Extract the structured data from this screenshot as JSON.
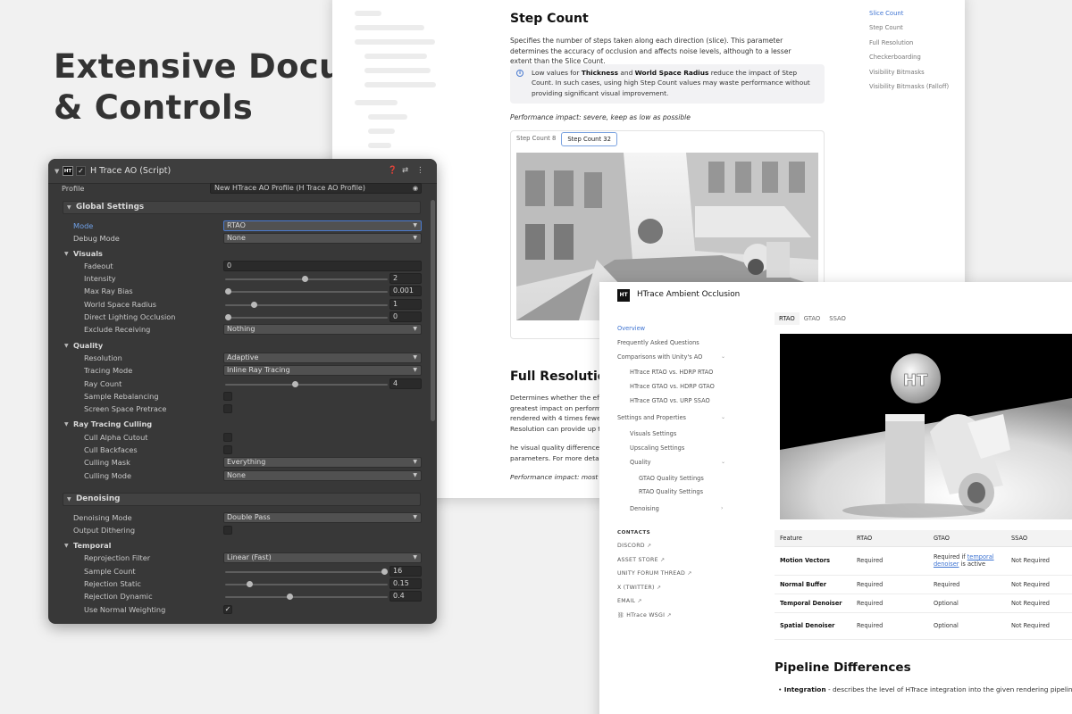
{
  "hero": {
    "line1": "Extensive Documentation",
    "line2": "& Controls"
  },
  "doc_page": {
    "heading": "Step Count",
    "paragraph": "Specifies the number of steps taken along each direction (slice). This parameter determines the accuracy of occlusion and affects noise levels, although to a lesser extent than the Slice Count.",
    "callout": {
      "pre": "Low values for ",
      "bold1": "Thickness",
      "mid": " and ",
      "bold2": "World Space Radius",
      "post": " reduce the impact of Step Count. In such cases, using high Step Count values may waste performance without providing significant visual improvement."
    },
    "perf_note": "Performance impact: severe, keep as low as possible",
    "tabs": [
      "Step Count 8",
      "Step Count 32"
    ],
    "toc": [
      "Slice Count",
      "Step Count",
      "Full Resolution",
      "Checkerboarding",
      "Visibility Bitmasks",
      "Visibility Bitmasks (Falloff)"
    ],
    "heading2": "Full Resolution",
    "paragraph2": "Determines whether the effe greatest impact on performan rendered with 4 times fewer Resolution can provide up to",
    "paragraph3": "he visual quality difference b parameters. For more details",
    "perf_note2": "Performance impact: most se"
  },
  "inspector": {
    "title": "H Trace AO (Script)",
    "badge": "HT",
    "profile_label": "Profile",
    "profile_value": "New HTrace AO Profile (H Trace AO Profile)",
    "sections": {
      "global": "Global Settings",
      "visuals": "Visuals",
      "quality": "Quality",
      "rtc": "Ray Tracing Culling",
      "denoising": "Denoising",
      "temporal": "Temporal"
    },
    "mode": {
      "label": "Mode",
      "value": "RTAO"
    },
    "debug_mode": {
      "label": "Debug Mode",
      "value": "None"
    },
    "fadeout": {
      "label": "Fadeout",
      "value": "0"
    },
    "intensity": {
      "label": "Intensity",
      "value": "2",
      "fraction": 0.49
    },
    "max_ray_bias": {
      "label": "Max Ray Bias",
      "value": "0.001",
      "fraction": 0.02
    },
    "world_space_radius": {
      "label": "World Space Radius",
      "value": "1",
      "fraction": 0.18
    },
    "direct_lighting_occlusion": {
      "label": "Direct Lighting Occlusion",
      "value": "0",
      "fraction": 0.02
    },
    "exclude_receiving": {
      "label": "Exclude Receiving",
      "value": "Nothing"
    },
    "resolution": {
      "label": "Resolution",
      "value": "Adaptive"
    },
    "tracing_mode": {
      "label": "Tracing Mode",
      "value": "Inline Ray Tracing"
    },
    "ray_count": {
      "label": "Ray Count",
      "value": "4",
      "fraction": 0.43
    },
    "sample_rebalancing": {
      "label": "Sample Rebalancing"
    },
    "screen_space_pretrace": {
      "label": "Screen Space Pretrace"
    },
    "cull_alpha_cutout": {
      "label": "Cull Alpha Cutout"
    },
    "cull_backfaces": {
      "label": "Cull Backfaces"
    },
    "culling_mask": {
      "label": "Culling Mask",
      "value": "Everything"
    },
    "culling_mode": {
      "label": "Culling Mode",
      "value": "None"
    },
    "denoising_mode": {
      "label": "Denoising Mode",
      "value": "Double Pass"
    },
    "output_dithering": {
      "label": "Output Dithering"
    },
    "reprojection_filter": {
      "label": "Reprojection Filter",
      "value": "Linear (Fast)"
    },
    "sample_count": {
      "label": "Sample Count",
      "value": "16",
      "fraction": 0.98
    },
    "rejection_static": {
      "label": "Rejection Static",
      "value": "0.15",
      "fraction": 0.15
    },
    "rejection_dynamic": {
      "label": "Rejection Dynamic",
      "value": "0.4",
      "fraction": 0.4
    },
    "use_normal_weighting": {
      "label": "Use Normal Weighting",
      "checked": true
    }
  },
  "doc_site": {
    "logo": "HT",
    "title": "HTrace Ambient Occlusion",
    "nav": {
      "overview": "Overview",
      "faq": "Frequently Asked Questions",
      "comparisons": "Comparisons with Unity's AO",
      "cmp1": "HTrace RTAO vs. HDRP RTAO",
      "cmp2": "HTrace GTAO vs. HDRP GTAO",
      "cmp3": "HTrace GTAO vs. URP SSAO",
      "settings": "Settings and Properties",
      "visuals": "Visuals Settings",
      "upscaling": "Upscaling Settings",
      "quality": "Quality",
      "gtao_q": "GTAO Quality Settings",
      "rtao_q": "RTAO Quality Settings",
      "denoising": "Denoising"
    },
    "contacts_heading": "CONTACTS",
    "contacts": [
      "DISCORD",
      "ASSET STORE",
      "UNITY FORUM THREAD",
      "X (TWITTER)",
      "EMAIL",
      "HTrace WSGI"
    ],
    "tabs": [
      "RTAO",
      "GTAO",
      "SSAO"
    ],
    "table": {
      "headers": [
        "Feature",
        "RTAO",
        "GTAO",
        "SSAO"
      ],
      "rows": [
        {
          "feature": "Motion Vectors",
          "rtao": "Required",
          "gtao_pre": "Required if ",
          "gtao_link": "temporal denoiser",
          "gtao_post": " is active",
          "ssao": "Not Required"
        },
        {
          "feature": "Normal Buffer",
          "rtao": "Required",
          "gtao": "Required",
          "ssao": "Not Required"
        },
        {
          "feature": "Temporal Denoiser",
          "rtao": "Required",
          "gtao": "Optional",
          "ssao": "Not Required"
        },
        {
          "feature": "Spatial Denoiser",
          "rtao": "Required",
          "gtao": "Optional",
          "ssao": "Not Required"
        }
      ]
    },
    "heading": "Pipeline Differences",
    "bullet_bold": "Integration",
    "bullet_text": " - describes the level of HTrace integration into the given rendering pipeline."
  }
}
